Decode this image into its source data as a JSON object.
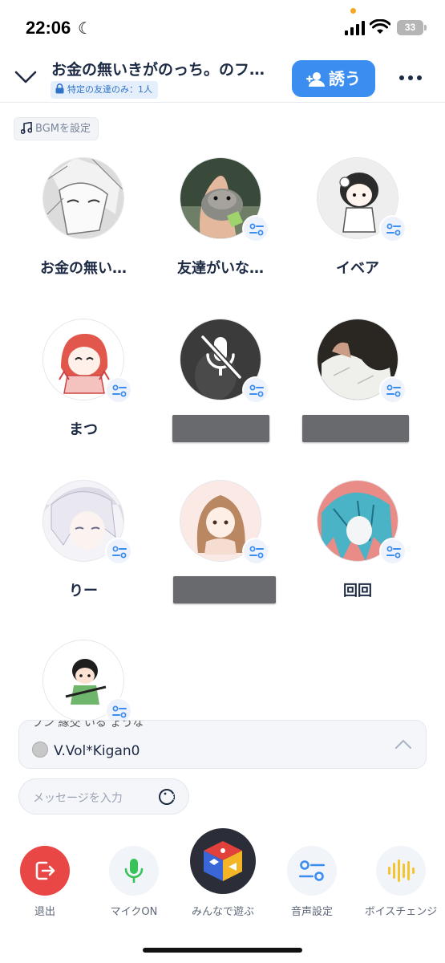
{
  "status_bar": {
    "time": "22:06",
    "battery": "33"
  },
  "header": {
    "title": "お金の無いきがのっち。のフ…",
    "privacy": "特定の友達のみ：1人",
    "invite_label": "誘う"
  },
  "bgm_label": "BGMを設定",
  "members": [
    {
      "name": "お金の無い…",
      "redacted": false
    },
    {
      "name": "友達がいな…",
      "redacted": false
    },
    {
      "name": "イベア",
      "redacted": false
    },
    {
      "name": "まつ",
      "redacted": false
    },
    {
      "name": "",
      "redacted": true
    },
    {
      "name": "",
      "redacted": true
    },
    {
      "name": "りー",
      "redacted": false
    },
    {
      "name": "",
      "redacted": true
    },
    {
      "name": "回回",
      "redacted": false
    },
    {
      "name": "",
      "redacted": false
    }
  ],
  "chat_preview": {
    "cut_text": "ブン 縁交 いる ょうな",
    "latest_user": "V.Vol*Kigan0"
  },
  "message_input": {
    "placeholder": "メッセージを入力"
  },
  "toolbar": {
    "leave_label": "退出",
    "mic_label": "マイクON",
    "play_label": "みんなで遊ぶ",
    "audio_label": "音声設定",
    "voice_label": "ボイスチェンジ"
  },
  "colors": {
    "accent": "#3c8df0",
    "leave": "#e94646",
    "mic": "#39c25a",
    "voice": "#f5c531",
    "text": "#1d2a44"
  }
}
